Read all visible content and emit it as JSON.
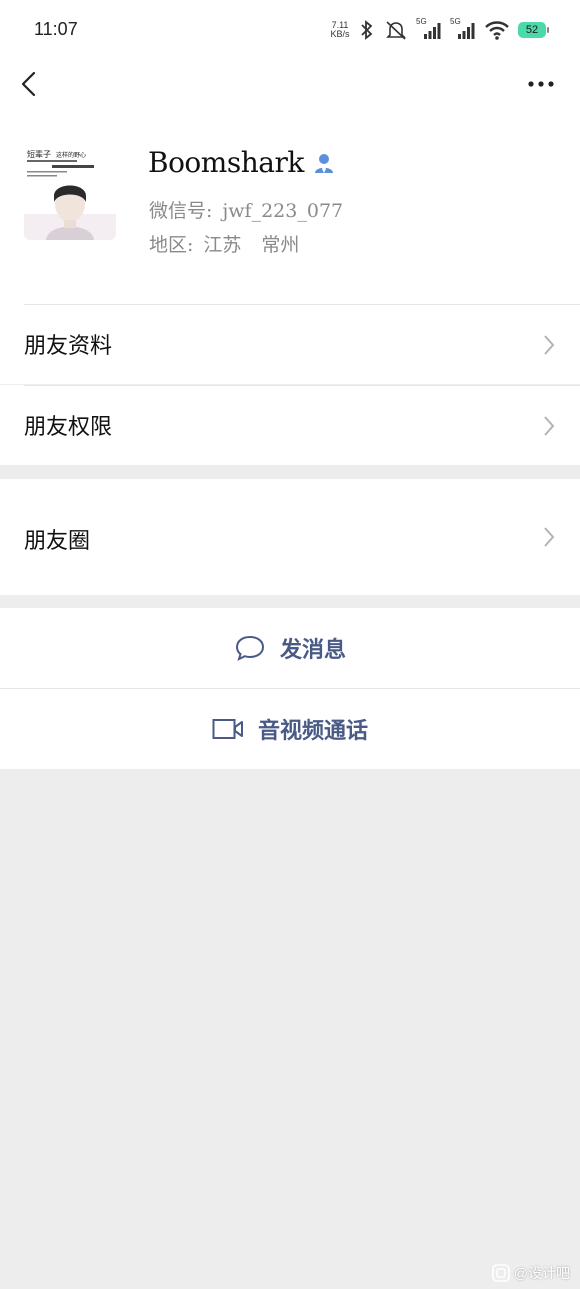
{
  "status_bar": {
    "time": "11:07",
    "net_speed_value": "7.11",
    "net_speed_unit": "KB/s",
    "sim1_tag": "5G",
    "sim2_tag": "5G",
    "battery": "52",
    "colors": {
      "battery": "#4cd9a8"
    }
  },
  "nav": {
    "back_icon": "chevron-left-icon",
    "more_icon": "more-dots-icon"
  },
  "profile": {
    "avatar_caption_line1": "短辈子",
    "avatar_caption_line2": "这样的野心",
    "name": "Boomshark",
    "gender_icon": "person-icon",
    "wechat_id_label": "微信号:",
    "wechat_id": "jwf_223_077",
    "region_label": "地区:",
    "region_province": "江苏",
    "region_city": "常州"
  },
  "menu": {
    "friend_profile": "朋友资料",
    "friend_permissions": "朋友权限",
    "moments": "朋友圈"
  },
  "actions": {
    "send_message": "发消息",
    "av_call": "音视频通话",
    "accent_color": "#4a5a87"
  },
  "watermark": "@设计吧"
}
